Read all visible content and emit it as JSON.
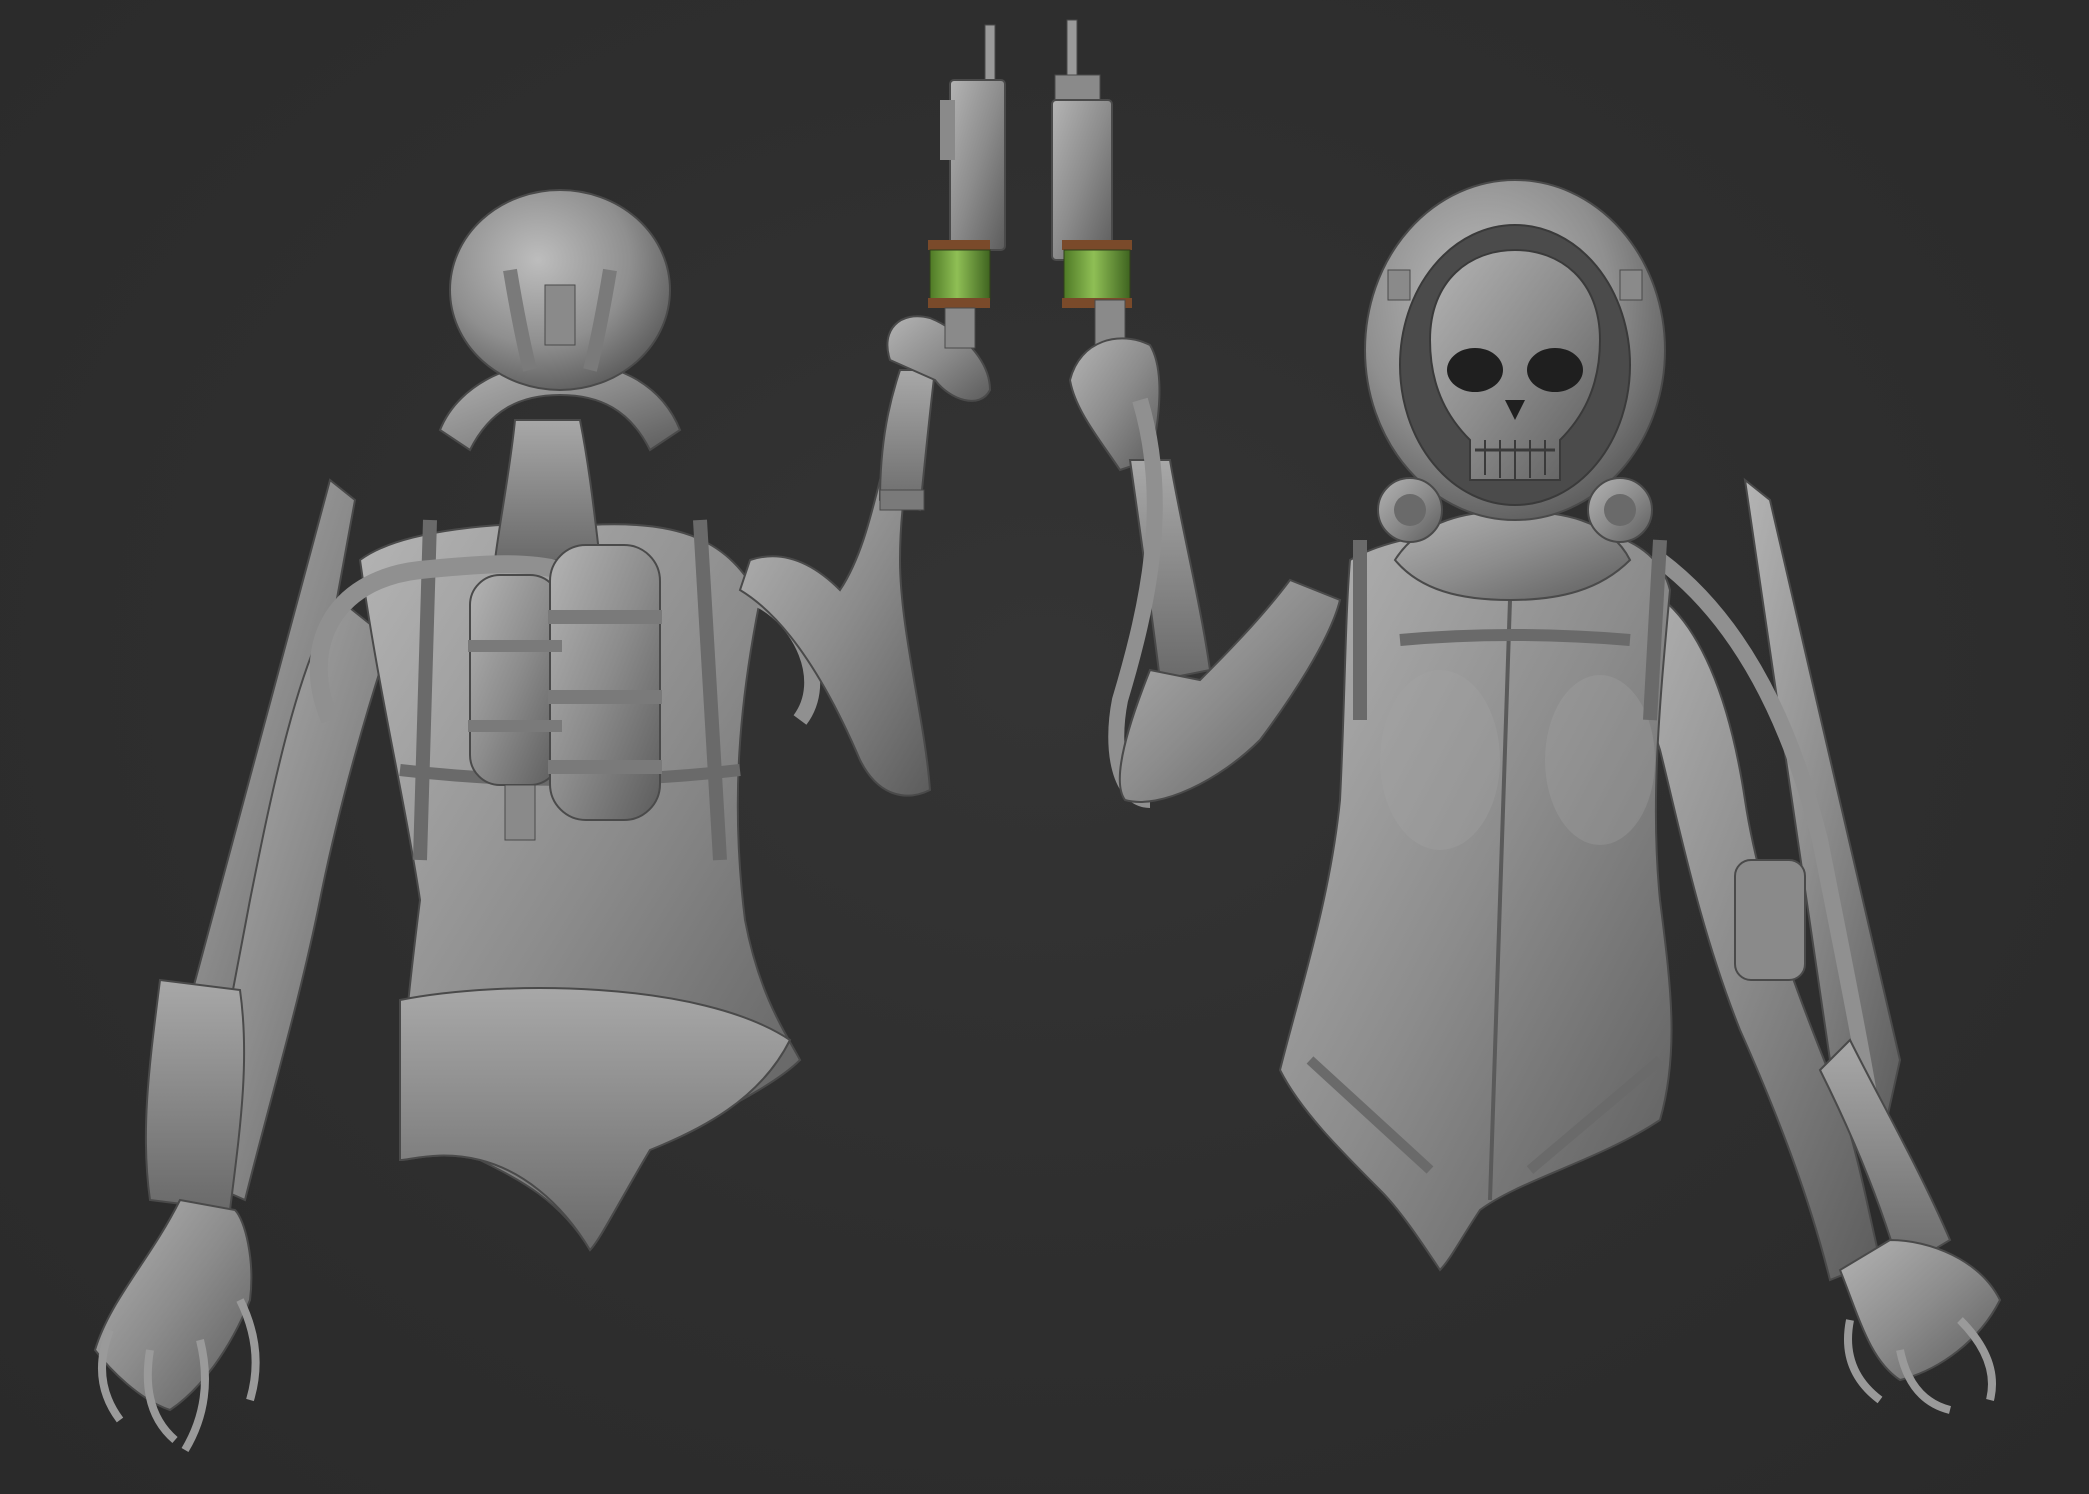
{
  "colors": {
    "background": "#2f2f2f",
    "clay_light": "#a9a9a9",
    "clay_mid": "#8a8a8a",
    "clay_dark": "#5e5e5e",
    "canister_green": "#6f9a3a",
    "canister_band": "#7a4a2a"
  },
  "figures": [
    {
      "view": "back"
    },
    {
      "view": "front"
    }
  ]
}
